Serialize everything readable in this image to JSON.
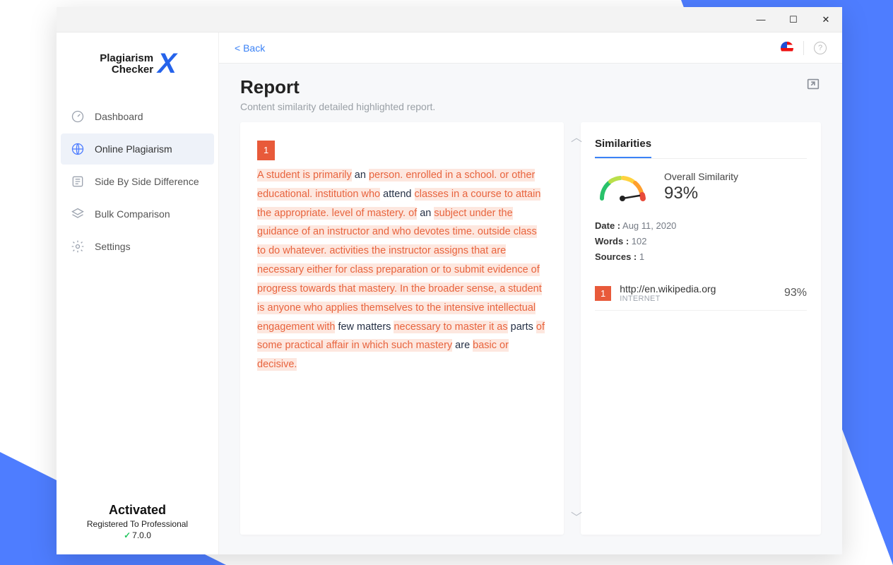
{
  "logo": {
    "line1": "Plagiarism",
    "line2": "Checker"
  },
  "window_controls": {
    "minimize": "—",
    "maximize": "☐",
    "close": "✕"
  },
  "sidebar": {
    "items": [
      {
        "label": "Dashboard"
      },
      {
        "label": "Online Plagiarism"
      },
      {
        "label": "Side By Side Difference"
      },
      {
        "label": "Bulk Comparison"
      },
      {
        "label": "Settings"
      }
    ],
    "activation": {
      "title": "Activated",
      "subtitle": "Registered To Professional",
      "version": "7.0.0"
    }
  },
  "topbar": {
    "back": "<  Back"
  },
  "header": {
    "title": "Report",
    "subtitle": "Content similarity detailed highlighted report."
  },
  "report": {
    "badge": "1",
    "segments": [
      {
        "t": "A student is primarily",
        "h": true
      },
      {
        "t": " an ",
        "h": false
      },
      {
        "t": "person. enrolled in a school. or other educational. institution who",
        "h": true
      },
      {
        "t": " attend ",
        "h": false
      },
      {
        "t": "classes in a course to attain the appropriate. level of mastery. of",
        "h": true
      },
      {
        "t": " an ",
        "h": false
      },
      {
        "t": "subject under the guidance of an instructor and who devotes time. outside class to do whatever. activities the instructor assigns that are necessary either for class preparation or to submit evidence of progress towards that mastery. In the broader sense, a student is anyone who applies themselves to the intensive intellectual engagement with",
        "h": true
      },
      {
        "t": " few matters ",
        "h": false
      },
      {
        "t": "necessary to master it as",
        "h": true
      },
      {
        "t": " parts ",
        "h": false
      },
      {
        "t": "of some practical affair in which such mastery",
        "h": true
      },
      {
        "t": " are ",
        "h": false
      },
      {
        "t": "basic or decisive.",
        "h": true
      }
    ]
  },
  "similarities": {
    "title": "Similarities",
    "overall_label": "Overall Similarity",
    "overall_pct": "93%",
    "date_label": "Date :",
    "date": "Aug 11, 2020",
    "words_label": "Words :",
    "words": "102",
    "sources_label": "Sources :",
    "sources_count": "1",
    "sources": [
      {
        "badge": "1",
        "url": "http://en.wikipedia.org",
        "type": "INTERNET",
        "pct": "93%"
      }
    ]
  }
}
